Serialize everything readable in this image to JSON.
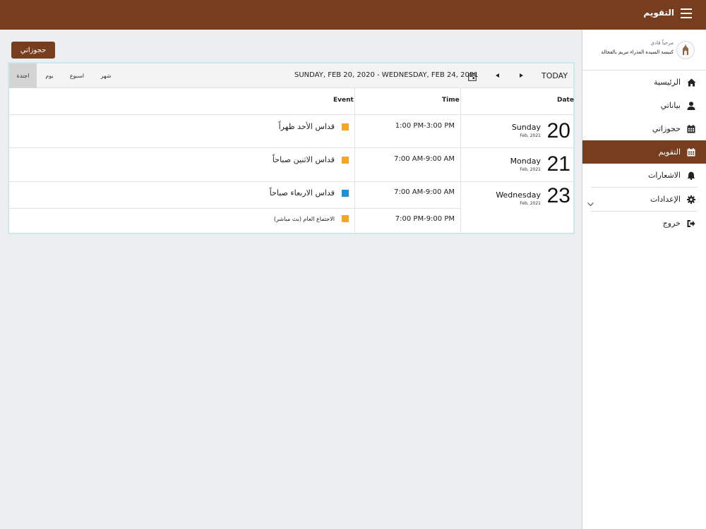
{
  "header": {
    "title": "التقويم",
    "menu_icon": "hamburger-icon"
  },
  "sidebar": {
    "greeting": "مرحباً فادي",
    "church": "كنيسة السيدة العذراء مريم بالفجالة",
    "items": [
      {
        "label": "الرئيسية",
        "icon": "home-icon",
        "active": false
      },
      {
        "label": "بياناتي",
        "icon": "user-icon",
        "active": false
      },
      {
        "label": "حجوزاتي",
        "icon": "calendar-icon",
        "active": false
      },
      {
        "label": "التقويم",
        "icon": "calendar-icon",
        "active": true
      },
      {
        "label": "الاشعارات",
        "icon": "bell-icon",
        "active": false
      },
      {
        "label": "الإعدادات",
        "icon": "gear-icon",
        "active": false
      },
      {
        "label": "خروج",
        "icon": "logout-icon",
        "active": false
      }
    ]
  },
  "main": {
    "reserve_button": "حجوزاتي",
    "toolbar": {
      "views": [
        "اجندة",
        "يوم",
        "اسبوع",
        "شهر"
      ],
      "selected_view": "اجندة",
      "range": "SUNDAY, FEB 20, 2020 - WEDNESDAY, FEB 24, 2021",
      "today": "TODAY"
    },
    "columns": {
      "date": "Date",
      "time": "Time",
      "event": "Event"
    },
    "days": [
      {
        "num": "20",
        "day": "Sunday",
        "month": "Feb, 2021"
      },
      {
        "num": "21",
        "day": "Monday",
        "month": "Feb, 2021"
      },
      {
        "num": "23",
        "day": "Wednesday",
        "month": "Feb, 2021"
      }
    ],
    "events": [
      {
        "time": "1:00 PM-3:00 PM",
        "title": "قداس الأحد ظهراً",
        "color": "#f5a623"
      },
      {
        "time": "7:00 AM-9:00 AM",
        "title": "قداس الاثنين صباحاً",
        "color": "#f5a623"
      },
      {
        "time": "7:00 AM-9:00 AM",
        "title": "قداس الاربعاء صباحاً",
        "color": "#1e90d8"
      },
      {
        "time": "7:00 PM-9:00 PM",
        "title": "الاجتماع العام (بث مباشر)",
        "color": "#f5a623"
      }
    ]
  },
  "colors": {
    "brand": "#763e1f",
    "background": "#eceef0"
  }
}
